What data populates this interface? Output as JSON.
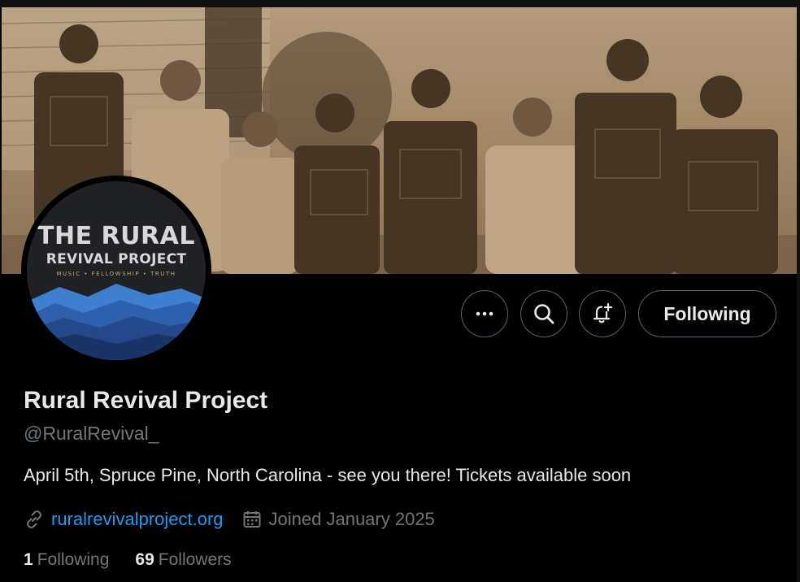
{
  "avatar": {
    "logo_line1": "THE RURAL",
    "logo_line2": "REVIVAL PROJECT",
    "logo_line3": "MUSIC • FELLOWSHIP • TRUTH"
  },
  "actions": {
    "more_icon": "more-horizontal-icon",
    "search_icon": "search-icon",
    "notify_icon": "bell-plus-icon",
    "follow_label": "Following"
  },
  "profile": {
    "name": "Rural Revival Project",
    "handle": "@RuralRevival_",
    "bio": "April 5th, Spruce Pine, North Carolina - see you there! Tickets available soon",
    "link": "ruralrevivalproject.org",
    "joined": "Joined January 2025"
  },
  "stats": {
    "following_count": "1",
    "following_label": "Following",
    "followers_count": "69",
    "followers_label": "Followers"
  },
  "colors": {
    "background": "#000000",
    "text": "#e7e9ea",
    "secondary": "#71767b",
    "link": "#1d9bf0",
    "border": "#536471"
  }
}
